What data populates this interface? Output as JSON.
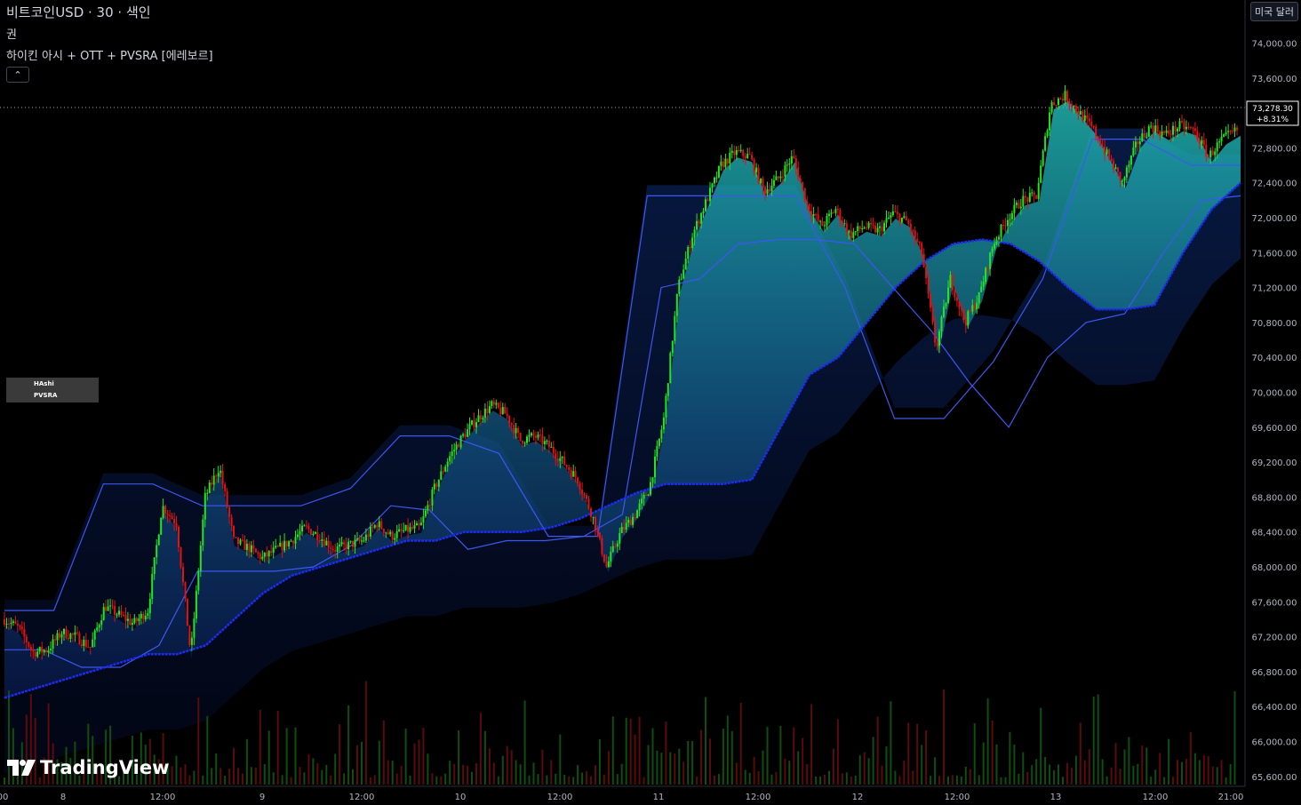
{
  "header": {
    "symbol_line": "비트코인USD · 30 · 색인",
    "line2": "권",
    "indicator_line": "하이킨 아시 + OTT + PVSRA [에레보르]",
    "collapse_icon": "chevron-up-icon"
  },
  "currency_button": "미국 달러",
  "legend_box": [
    "HAshi",
    "PVSRA"
  ],
  "logo_text": "TradingView",
  "chart_data": {
    "type": "line",
    "title": "",
    "xlabel": "",
    "ylabel": "",
    "x_tick_labels": [
      "00",
      "8",
      "12:00",
      "9",
      "12:00",
      "10",
      "12:00",
      "11",
      "12:00",
      "12",
      "12:00",
      "13",
      "12:00",
      "21:00"
    ],
    "y_tick_labels": [
      "74,000.00",
      "73,600.00",
      "72,800.00",
      "72,400.00",
      "72,000.00",
      "71,600.00",
      "71,200.00",
      "70,800.00",
      "70,400.00",
      "70,000.00",
      "69,600.00",
      "69,200.00",
      "68,800.00",
      "68,400.00",
      "68,000.00",
      "67,600.00",
      "67,200.00",
      "66,800.00",
      "66,400.00",
      "66,000.00",
      "65,600.00"
    ],
    "ylim": [
      65500,
      74400
    ],
    "last_price_label": "73,278.30",
    "last_change_label": "+8.31%",
    "last_price": 73278.3,
    "grid": false,
    "colors": {
      "up": "#22e61e",
      "down": "#e01313",
      "ott": "#1c2df0",
      "band": "#3c58f0",
      "fill": "#1fb5b0"
    },
    "series": [
      {
        "values": [
          67400,
          67300,
          67020,
          67050,
          67250,
          67200,
          67080,
          67550,
          67450,
          67350,
          67500,
          68700,
          68500,
          67000,
          68800,
          69150,
          68300,
          68220,
          68100,
          68200,
          68300,
          68450,
          68350,
          68200,
          68250,
          68300,
          68500,
          68350,
          68420,
          68450,
          68900,
          69250,
          69500,
          69700,
          69850,
          69750,
          69450,
          69500,
          69380,
          69200,
          69000,
          68600,
          68000,
          68400,
          68600,
          68900,
          69700,
          71200,
          71800,
          72200,
          72600,
          72750,
          72700,
          72300,
          72450,
          72700,
          72150,
          71900,
          72100,
          71800,
          71900,
          71850,
          72050,
          71950,
          71600,
          70500,
          71300,
          70800,
          71100,
          71700,
          72000,
          72200,
          72250,
          73300,
          73400,
          73200,
          73000,
          72700,
          72400,
          72850,
          73050,
          72950,
          73050,
          73000,
          72700,
          72900,
          73000
        ]
      },
      {
        "values": [
          66500,
          66600,
          66700,
          66800,
          66900,
          67000,
          67000,
          67100,
          67400,
          67700,
          67900,
          68000,
          68100,
          68200,
          68300,
          68300,
          68400,
          68400,
          68400,
          68450,
          68550,
          68700,
          68850,
          68950,
          68950,
          68950,
          69000,
          69600,
          70200,
          70400,
          70800,
          71200,
          71500,
          71700,
          71750,
          71700,
          71500,
          71200,
          70950,
          70950,
          71000,
          71600,
          72100,
          72400
        ]
      },
      {
        "values": [
          67500,
          67500,
          68950,
          68950,
          68700,
          68700,
          68700,
          68900,
          69500,
          69500,
          69300,
          68350,
          68350,
          72250,
          72250,
          72250,
          72250,
          71200,
          69700,
          69700,
          70350,
          71300,
          72900,
          72900,
          72600,
          72600
        ]
      },
      {
        "values": [
          67050,
          67050,
          66850,
          66850,
          67100,
          67950,
          67950,
          67950,
          68000,
          68250,
          68700,
          68650,
          68200,
          68300,
          68300,
          68350,
          68600,
          71200,
          71300,
          71700,
          71750,
          71750,
          71700,
          71200,
          70700,
          70100,
          69600,
          70400,
          70800,
          70900,
          71600,
          72200,
          72250
        ]
      }
    ],
    "volume_unlabeled": true
  }
}
